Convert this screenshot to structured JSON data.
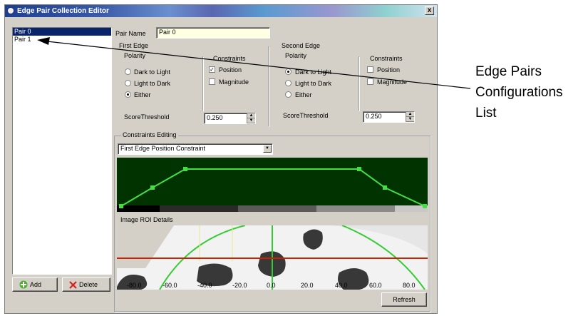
{
  "window": {
    "title": "Edge Pair Collection Editor",
    "close_label": "x"
  },
  "pairs": {
    "items": [
      "Pair 0",
      "Pair 1"
    ],
    "selected": "Pair 0"
  },
  "buttons": {
    "add": "Add",
    "delete": "Delete",
    "refresh": "Refresh"
  },
  "pair_name": {
    "label": "Pair Name",
    "value": "Pair 0"
  },
  "first_edge": {
    "label": "First Edge",
    "polarity_label": "Polarity",
    "polarity_options": [
      "Dark to Light",
      "Light to Dark",
      "Either"
    ],
    "polarity_selected": "Either",
    "constraints_label": "Constraints",
    "constraints": [
      {
        "label": "Position",
        "checked": true
      },
      {
        "label": "Magnitude",
        "checked": false
      }
    ],
    "score_label": "ScoreThreshold",
    "score_value": "0.250"
  },
  "second_edge": {
    "label": "Second Edge",
    "polarity_label": "Polarity",
    "polarity_options": [
      "Dark to Light",
      "Light to Dark",
      "Either"
    ],
    "polarity_selected": "Dark to Light",
    "constraints_label": "Constraints",
    "constraints": [
      {
        "label": "Position",
        "checked": false
      },
      {
        "label": "Magnitude",
        "checked": false
      }
    ],
    "score_label": "ScoreThreshold",
    "score_value": "0.250"
  },
  "constraints_editing": {
    "label": "Constraints Editing",
    "selected": "First Edge Position Constraint"
  },
  "roi": {
    "label": "Image ROI Details",
    "axis_ticks": [
      "-80.0",
      "-60.0",
      "-40.0",
      "-20.0",
      "0.0",
      "20.0",
      "40.0",
      "60.0",
      "80.0"
    ]
  },
  "annotation": {
    "line1": "Edge Pairs",
    "line2": "Configurations",
    "line3": "List"
  },
  "colors": {
    "graph_bg": "#003300",
    "graph_line": "#44dd44",
    "selection": "#0a246a",
    "roi_line": "#cc2200"
  }
}
